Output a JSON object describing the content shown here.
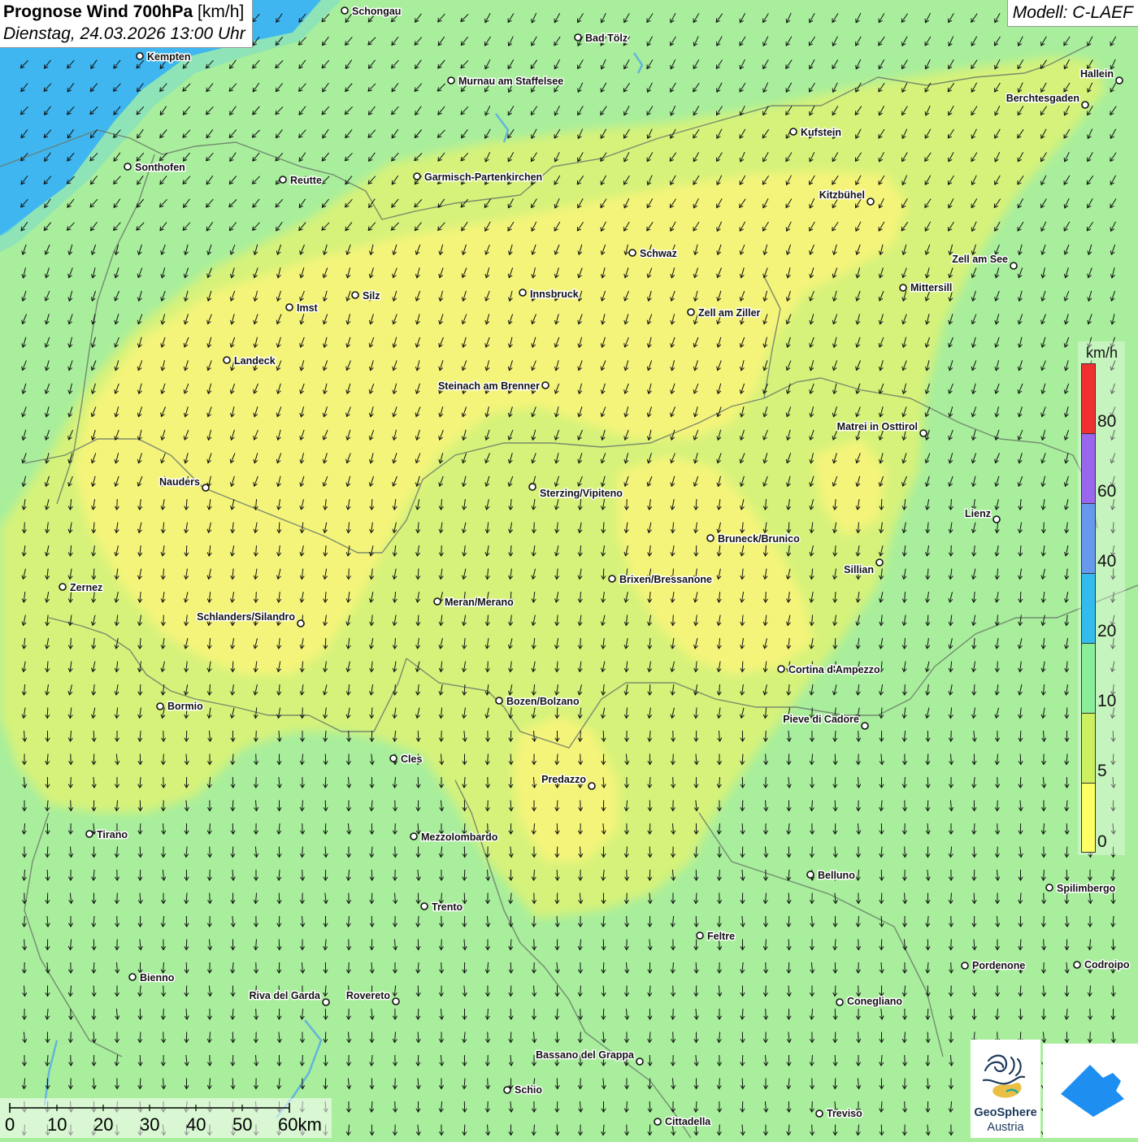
{
  "header": {
    "title_main": "Prognose Wind 700hPa",
    "title_unit": "[km/h]",
    "datetime": "Dienstag, 24.03.2026 13:00 Uhr",
    "model": "Modell: C-LAEF"
  },
  "legend": {
    "unit": "km/h",
    "ticks": [
      "80",
      "60",
      "40",
      "20",
      "10",
      "5",
      "0"
    ],
    "colors": [
      "#f03030",
      "#9a66ee",
      "#6699ee",
      "#33bbee",
      "#88ee99",
      "#ccf060",
      "#ffff66"
    ]
  },
  "scale": {
    "labels": [
      "0",
      "10",
      "20",
      "30",
      "40",
      "50",
      "60km"
    ]
  },
  "wind": {
    "direction": "mainly from north (arrows pointing south)",
    "colors": {
      "calm_0_5": "#f5f47a",
      "light_5_10": "#d6f27a",
      "moderate_10_20": "#a8ee9c",
      "strong_20_40": "#3fb6f0"
    }
  },
  "cities": [
    {
      "name": "Schongau"
    },
    {
      "name": "Bad Tölz"
    },
    {
      "name": "Kempten"
    },
    {
      "name": "Murnau am Staffelsee"
    },
    {
      "name": "Hallein"
    },
    {
      "name": "Berchtesgaden"
    },
    {
      "name": "Kufstein"
    },
    {
      "name": "Sonthofen"
    },
    {
      "name": "Reutte"
    },
    {
      "name": "Garmisch-Partenkirchen"
    },
    {
      "name": "Kitzbühel"
    },
    {
      "name": "Schwaz"
    },
    {
      "name": "Zell am See"
    },
    {
      "name": "Mittersill"
    },
    {
      "name": "Silz"
    },
    {
      "name": "Innsbruck"
    },
    {
      "name": "Imst"
    },
    {
      "name": "Zell am Ziller"
    },
    {
      "name": "Landeck"
    },
    {
      "name": "Steinach am Brenner"
    },
    {
      "name": "Matrei in Osttirol"
    },
    {
      "name": "Nauders"
    },
    {
      "name": "Sterzing/Vipiteno"
    },
    {
      "name": "Lienz"
    },
    {
      "name": "Bruneck/Brunico"
    },
    {
      "name": "Sillian"
    },
    {
      "name": "Brixen/Bressanone"
    },
    {
      "name": "Zernez"
    },
    {
      "name": "Meran/Merano"
    },
    {
      "name": "Schlanders/Silandro"
    },
    {
      "name": "Cortina d'Ampezzo"
    },
    {
      "name": "Bozen/Bolzano"
    },
    {
      "name": "Bormio"
    },
    {
      "name": "Pieve di Cadore"
    },
    {
      "name": "Cles"
    },
    {
      "name": "Predazzo"
    },
    {
      "name": "Tirano"
    },
    {
      "name": "Mezzolombardo"
    },
    {
      "name": "Belluno"
    },
    {
      "name": "Spilimbergo"
    },
    {
      "name": "Trento"
    },
    {
      "name": "Feltre"
    },
    {
      "name": "Pordenone"
    },
    {
      "name": "Codroipo"
    },
    {
      "name": "Bienno"
    },
    {
      "name": "Riva del Garda"
    },
    {
      "name": "Rovereto"
    },
    {
      "name": "Conegliano"
    },
    {
      "name": "Bassano del Grappa"
    },
    {
      "name": "Schio"
    },
    {
      "name": "Treviso"
    },
    {
      "name": "Cittadella"
    }
  ],
  "logos": {
    "geosphere_name": "GeoSphere",
    "geosphere_sub": "Austria"
  }
}
